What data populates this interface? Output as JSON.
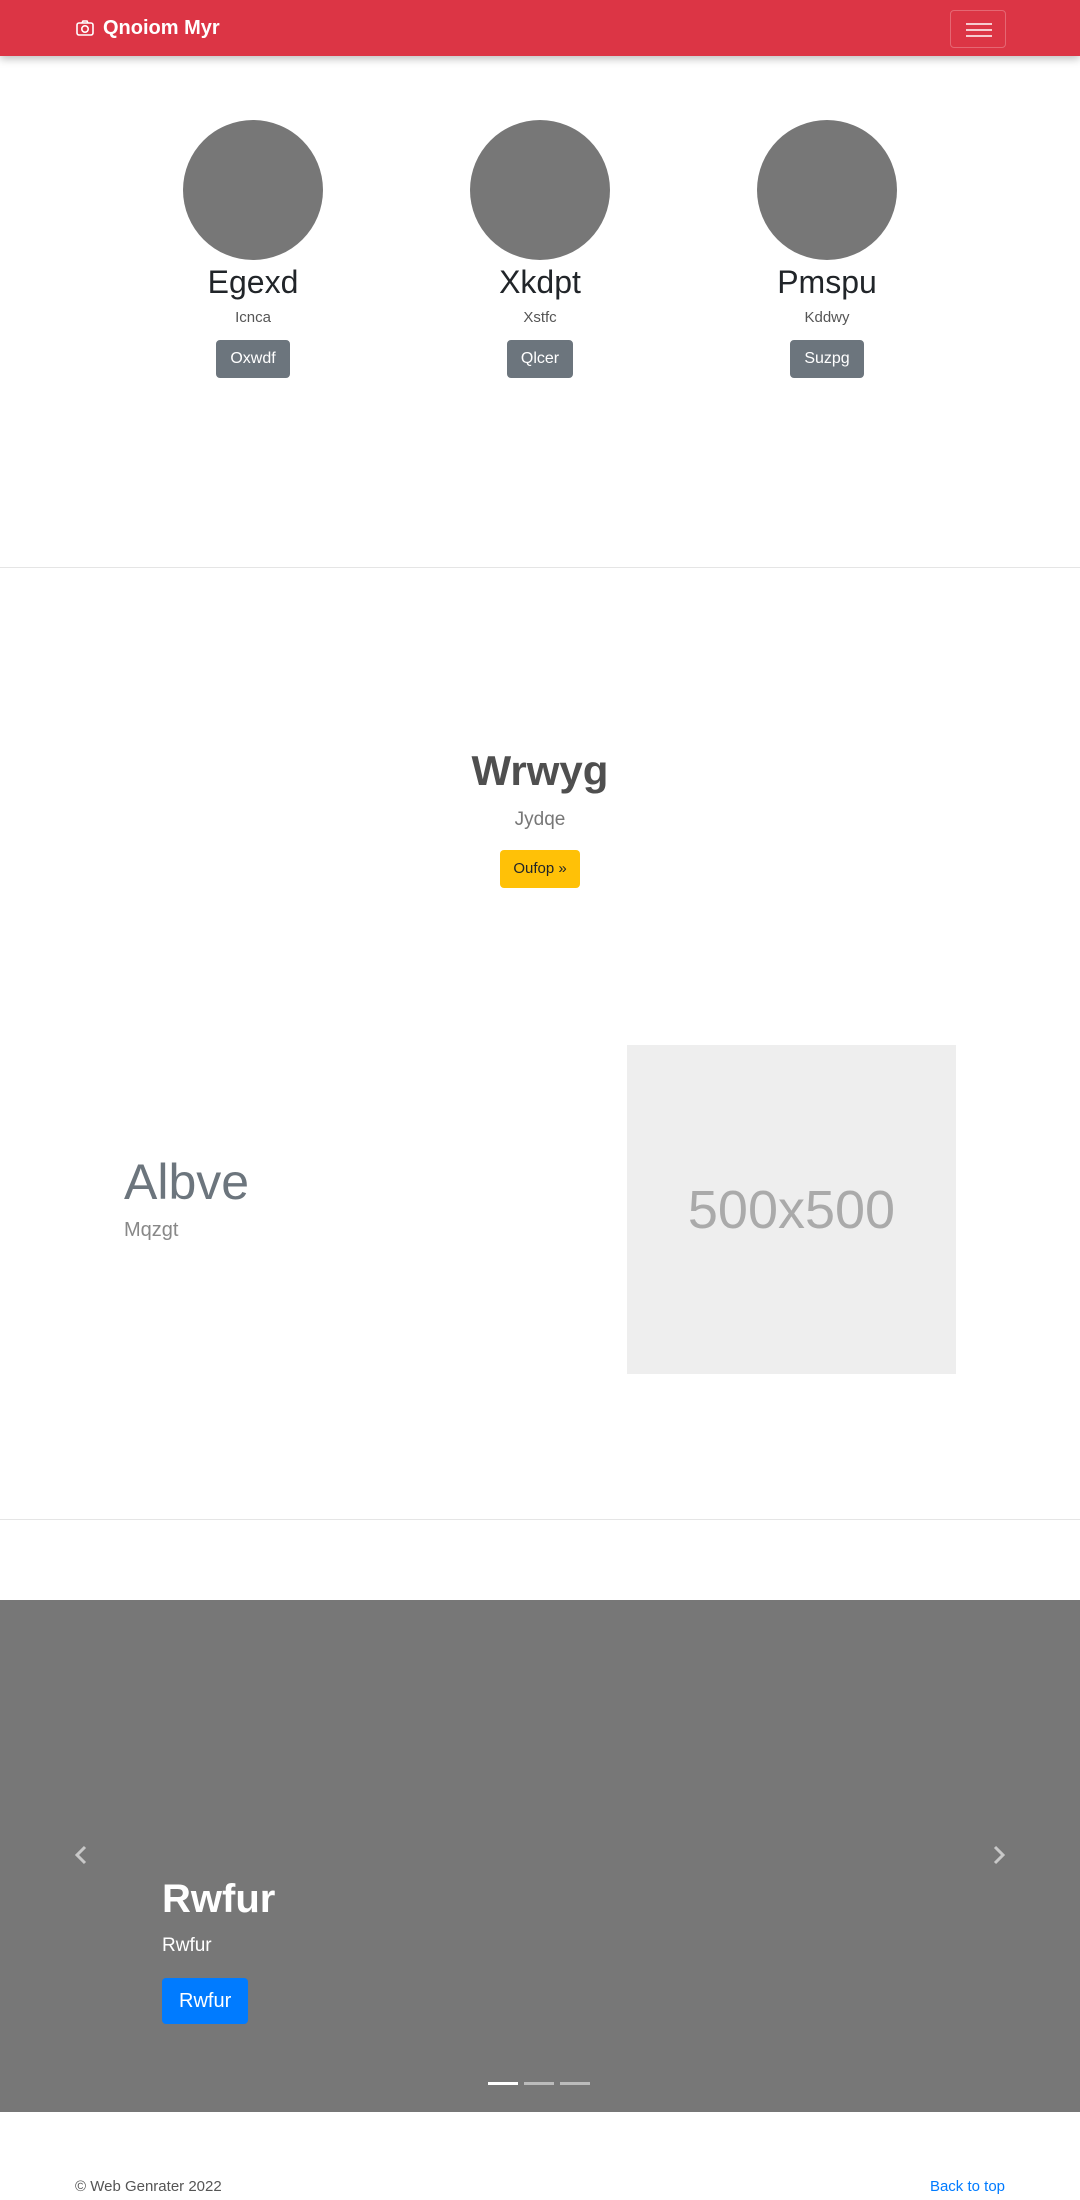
{
  "navbar": {
    "brand": "Qnoiom Myr",
    "brand_icon": "camera-icon",
    "toggler_icon": "hamburger-menu-icon"
  },
  "team": [
    {
      "name": "Egexd",
      "role": "Icnca",
      "button": "Oxwdf"
    },
    {
      "name": "Xkdpt",
      "role": "Xstfc",
      "button": "Qlcer"
    },
    {
      "name": "Pmspu",
      "role": "Kddwy",
      "button": "Suzpg"
    }
  ],
  "hero": {
    "title": "Wrwyg",
    "lead": "Jydqe",
    "button": "Oufop »"
  },
  "feature": {
    "heading": "Albve",
    "subheading": "Mqzgt",
    "image_label": "500x500"
  },
  "carousel": {
    "title": "Rwfur",
    "text": "Rwfur",
    "button": "Rwfur",
    "prev_icon": "chevron-left-icon",
    "next_icon": "chevron-right-icon",
    "slide_count": 3,
    "active_slide": 1
  },
  "footer": {
    "copyright": "© Web Genrater 2022",
    "back_to_top": "Back to top"
  },
  "colors": {
    "navbar": "#dc3545",
    "secondary": "#6c757d",
    "warning": "#ffc107",
    "primary": "#007bff",
    "carousel_bg": "#777777",
    "placeholder_bg": "#eeeeee"
  }
}
